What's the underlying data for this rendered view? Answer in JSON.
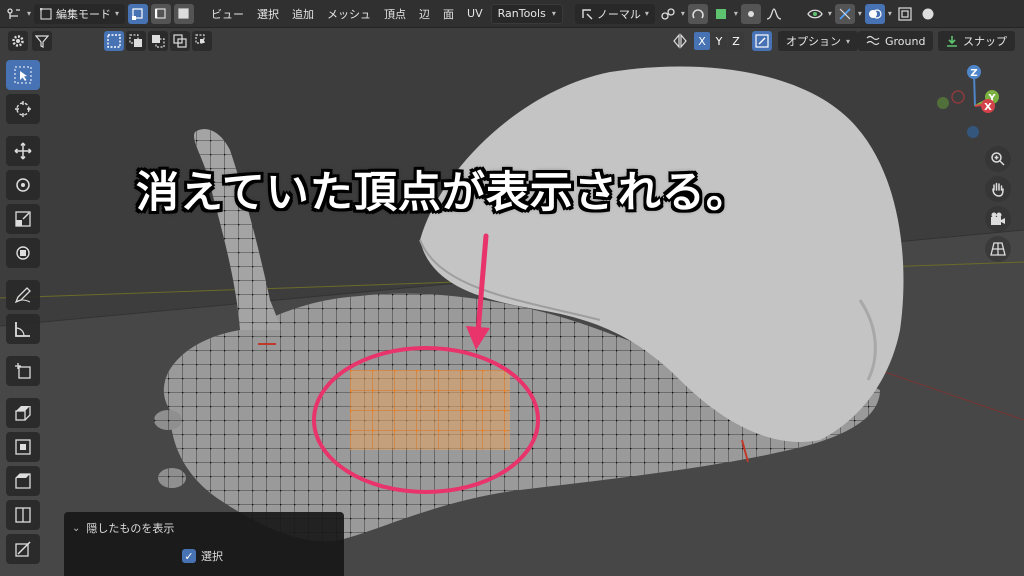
{
  "header": {
    "mode_label": "編集モード",
    "menus": [
      "ビュー",
      "選択",
      "追加",
      "メッシュ",
      "頂点",
      "辺",
      "面",
      "UV"
    ],
    "addon_label": "RanTools",
    "orientation_label": "ノーマル"
  },
  "toolbar2": {
    "axes": [
      "X",
      "Y",
      "Z"
    ],
    "options_label": "オプション",
    "ground_label": "Ground",
    "snap_label": "スナップ"
  },
  "annotation": {
    "text": "消えていた頂点が表示される。"
  },
  "operator_panel": {
    "title": "隠したものを表示",
    "checkbox_label": "選択",
    "checkbox_checked": true
  },
  "gizmo": {
    "z_label": "Z",
    "y_label": "Y",
    "x_label": "X"
  },
  "colors": {
    "accent": "#4772b3",
    "highlight": "#e8336b",
    "selected_vertex": "#f39a3c"
  }
}
